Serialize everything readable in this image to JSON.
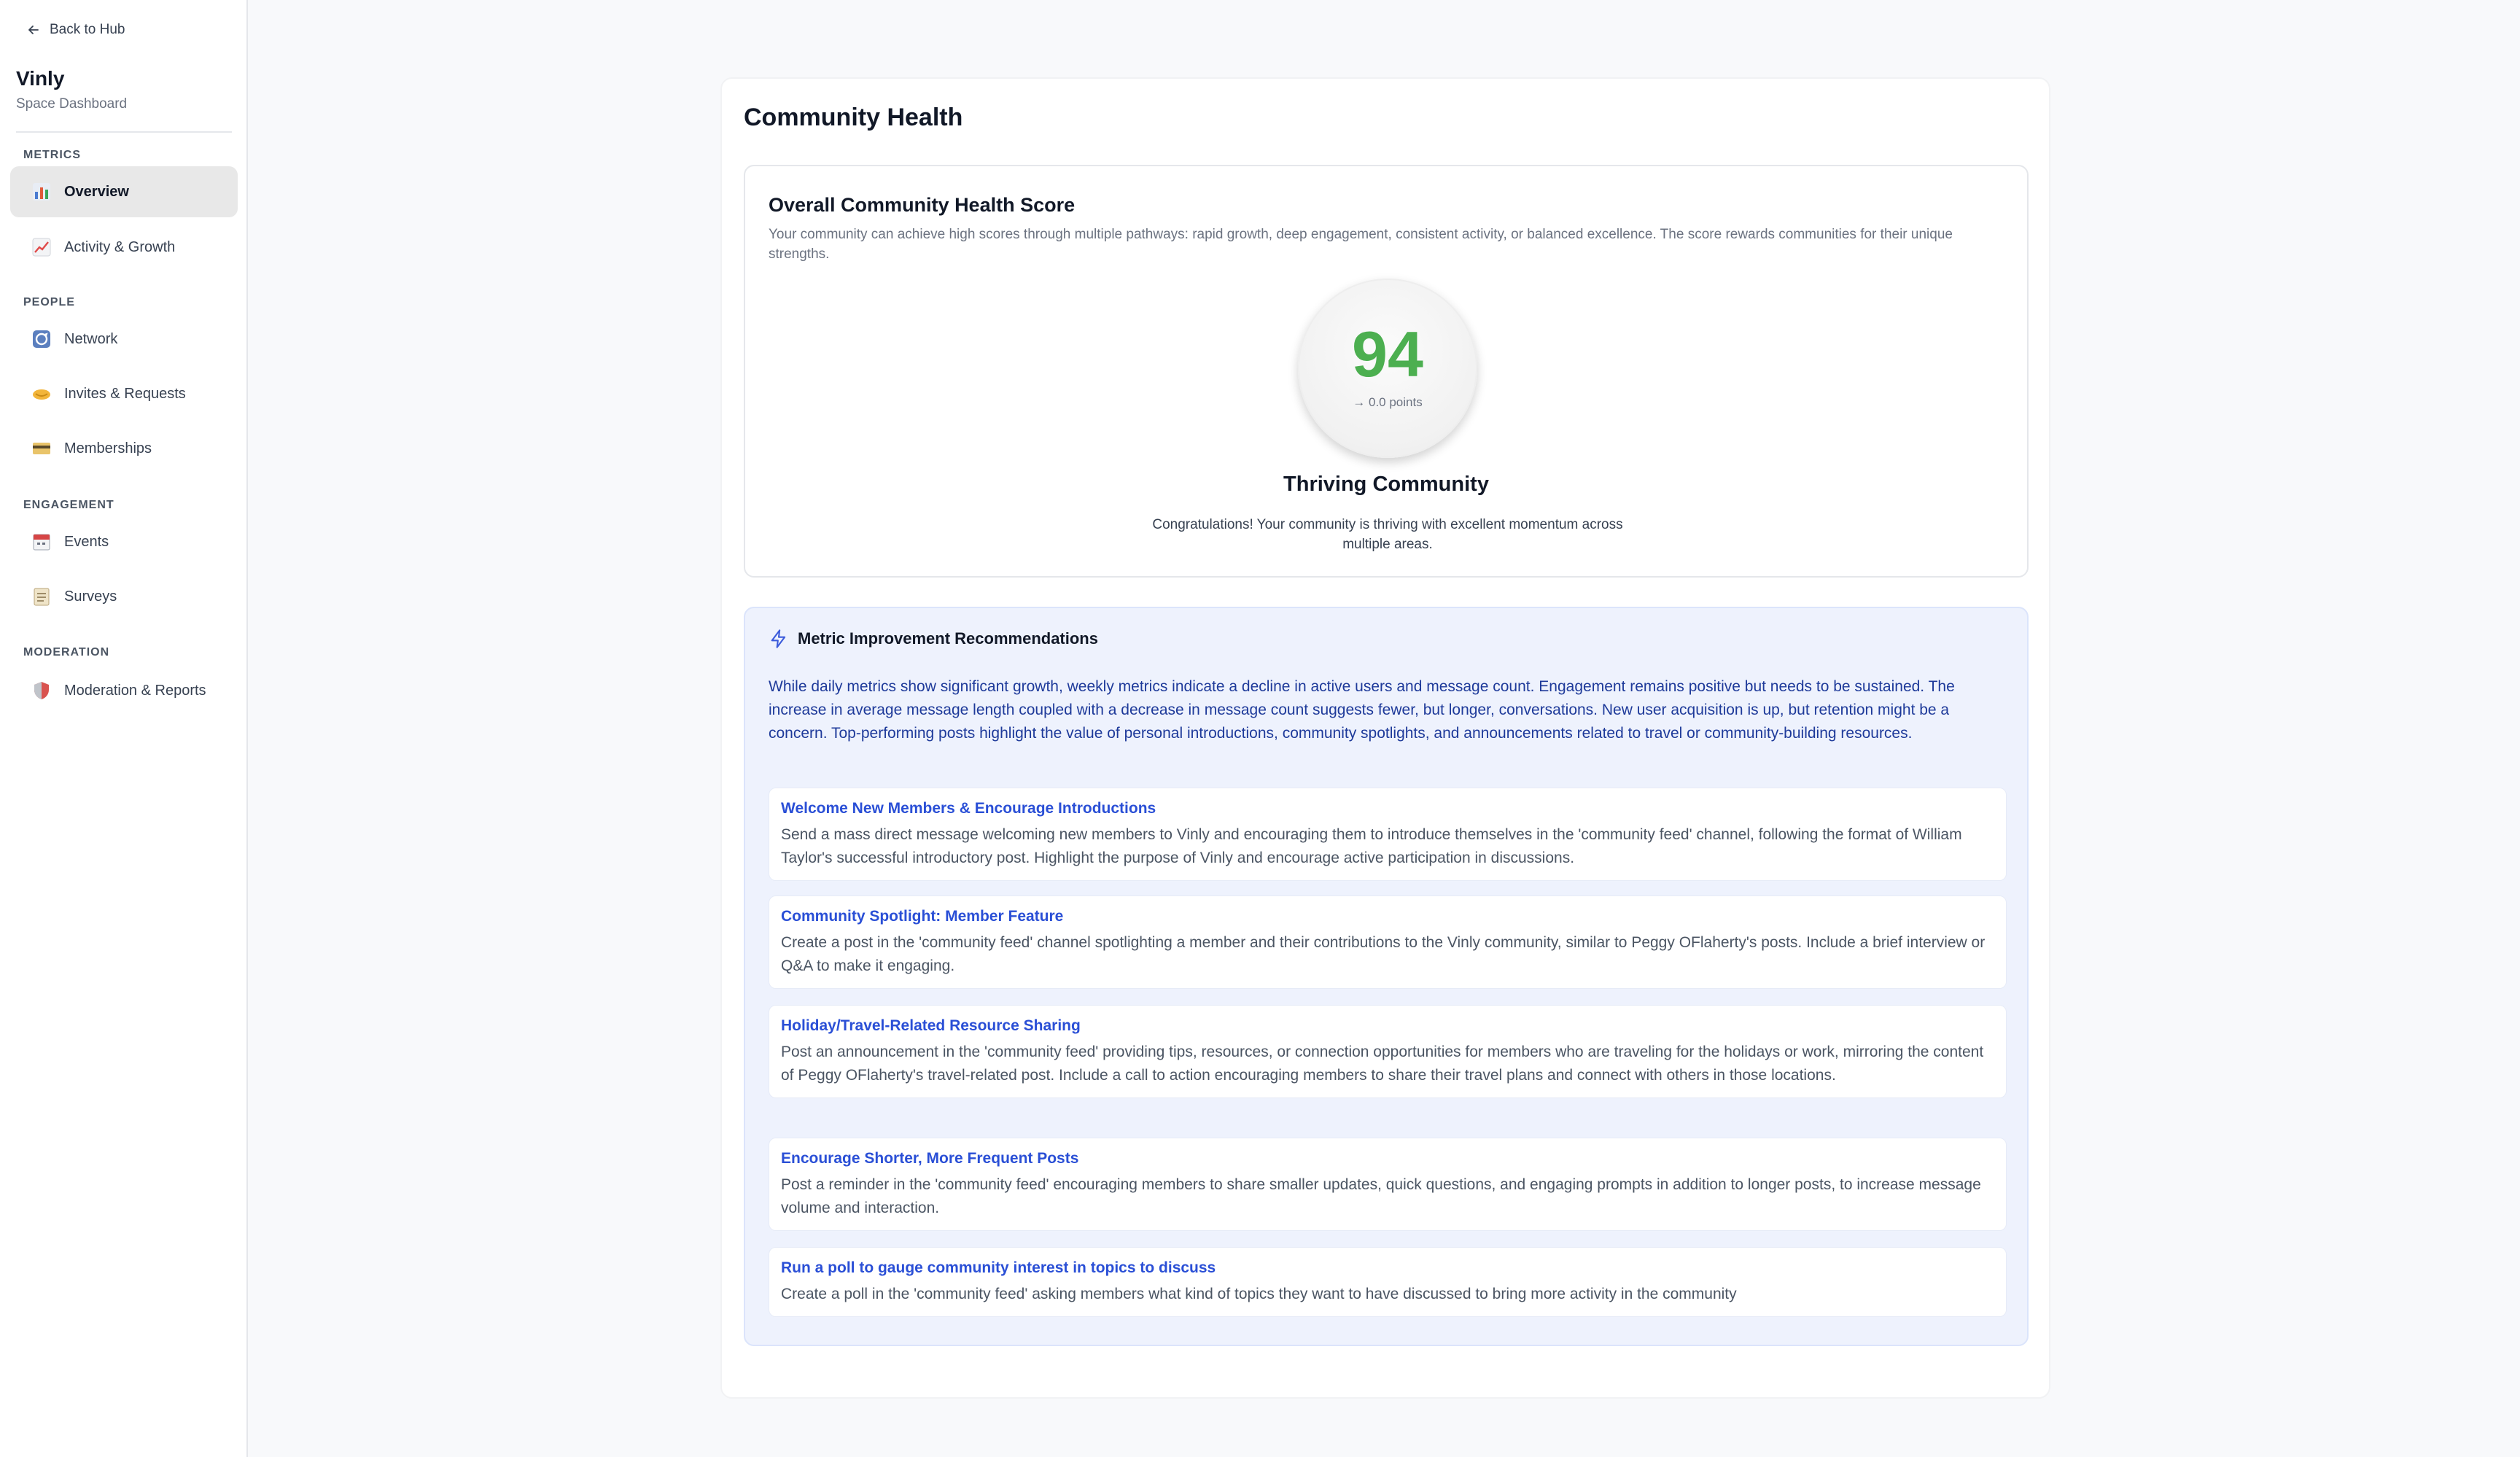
{
  "sidebar": {
    "back_label": "Back to Hub",
    "space_name": "Vinly",
    "space_subtitle": "Space Dashboard",
    "sections": {
      "metrics": "METRICS",
      "people": "PEOPLE",
      "engagement": "ENGAGEMENT",
      "moderation": "MODERATION"
    },
    "items": [
      {
        "label": "Overview",
        "icon": "bar-chart-icon"
      },
      {
        "label": "Activity & Growth",
        "icon": "trend-chart-icon"
      },
      {
        "label": "Network",
        "icon": "network-icon"
      },
      {
        "label": "Invites & Requests",
        "icon": "handshake-icon"
      },
      {
        "label": "Memberships",
        "icon": "credit-card-icon"
      },
      {
        "label": "Events",
        "icon": "calendar-icon"
      },
      {
        "label": "Surveys",
        "icon": "clipboard-icon"
      },
      {
        "label": "Moderation & Reports",
        "icon": "shield-icon"
      }
    ],
    "active_item": "Overview"
  },
  "main": {
    "title": "Community Health",
    "score_card": {
      "title": "Overall Community Health Score",
      "description": "Your community can achieve high scores through multiple pathways: rapid growth, deep engagement, consistent activity, or balanced excellence. The score rewards communities for their unique strengths.",
      "score": "94",
      "score_change": "→ 0.0 points",
      "label": "Thriving Community",
      "message": "Congratulations! Your community is thriving with excellent momentum across multiple areas.",
      "score_color": "#4caf50"
    },
    "recommendations": {
      "header": "Metric Improvement Recommendations",
      "summary": "While daily metrics show significant growth, weekly metrics indicate a decline in active users and message count. Engagement remains positive but needs to be sustained. The increase in average message length coupled with a decrease in message count suggests fewer, but longer, conversations. New user acquisition is up, but retention might be a concern. Top-performing posts highlight the value of personal introductions, community spotlights, and announcements related to travel or community-building resources.",
      "items": [
        {
          "title": "Welcome New Members & Encourage Introductions",
          "text": "Send a mass direct message welcoming new members to Vinly and encouraging them to introduce themselves in the 'community feed' channel, following the format of William Taylor's successful introductory post. Highlight the purpose of Vinly and encourage active participation in discussions."
        },
        {
          "title": "Community Spotlight: Member Feature",
          "text": "Create a post in the 'community feed' channel spotlighting a member and their contributions to the Vinly community, similar to Peggy OFlaherty's posts. Include a brief interview or Q&A to make it engaging."
        },
        {
          "title": "Holiday/Travel-Related Resource Sharing",
          "text": "Post an announcement in the 'community feed' providing tips, resources, or connection opportunities for members who are traveling for the holidays or work, mirroring the content of Peggy OFlaherty's travel-related post. Include a call to action encouraging members to share their travel plans and connect with others in those locations."
        },
        {
          "title": "Encourage Shorter, More Frequent Posts",
          "text": "Post a reminder in the 'community feed' encouraging members to share smaller updates, quick questions, and engaging prompts in addition to longer posts, to increase message volume and interaction."
        },
        {
          "title": "Run a poll to gauge community interest in topics to discuss",
          "text": "Create a poll in the 'community feed' asking members what kind of topics they want to have discussed to bring more activity in the community"
        }
      ]
    }
  }
}
